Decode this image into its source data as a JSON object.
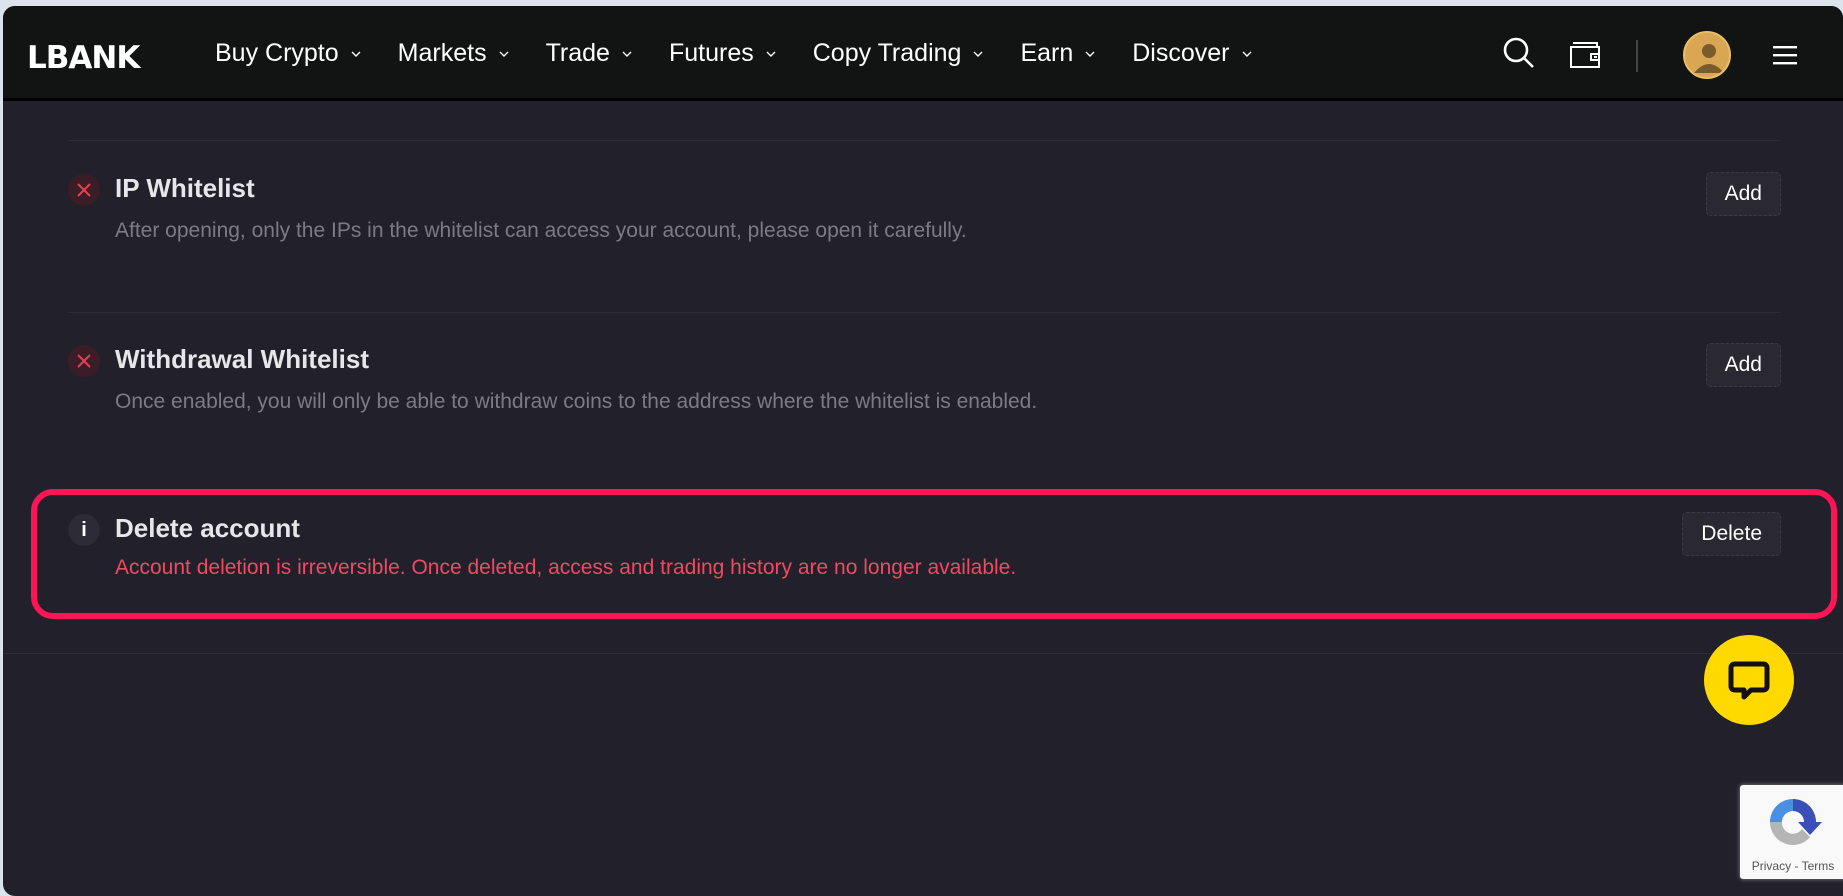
{
  "header": {
    "logo": "LBANK",
    "nav": [
      {
        "label": "Buy Crypto"
      },
      {
        "label": "Markets"
      },
      {
        "label": "Trade"
      },
      {
        "label": "Futures"
      },
      {
        "label": "Copy Trading"
      },
      {
        "label": "Earn"
      },
      {
        "label": "Discover"
      }
    ],
    "icons": [
      "search-icon",
      "wallet-icon",
      "avatar",
      "menu-icon"
    ]
  },
  "security_items": [
    {
      "title": "IP Whitelist",
      "description": "After opening, only the IPs in the whitelist can access your account, please open it carefully.",
      "status": "disabled",
      "status_icon": "close-icon",
      "action_label": "Add"
    },
    {
      "title": "Withdrawal Whitelist",
      "description": "Once enabled, you will only be able to withdraw coins to the address where the whitelist is enabled.",
      "status": "disabled",
      "status_icon": "close-icon",
      "action_label": "Add"
    },
    {
      "title": "Delete account",
      "description": "Account deletion is irreversible. Once deleted, access and trading history are no longer available.",
      "status": "info",
      "status_icon_text": "i",
      "action_label": "Delete",
      "highlighted": true
    }
  ],
  "colors": {
    "background": "#22202a",
    "header": "#121313",
    "danger_text": "#ef4a62",
    "highlight_border": "#ff1456",
    "chat_fab": "#ffd900",
    "avatar": "#d9a654"
  },
  "recaptcha": {
    "privacy": "Privacy",
    "separator": " - ",
    "terms": "Terms"
  }
}
